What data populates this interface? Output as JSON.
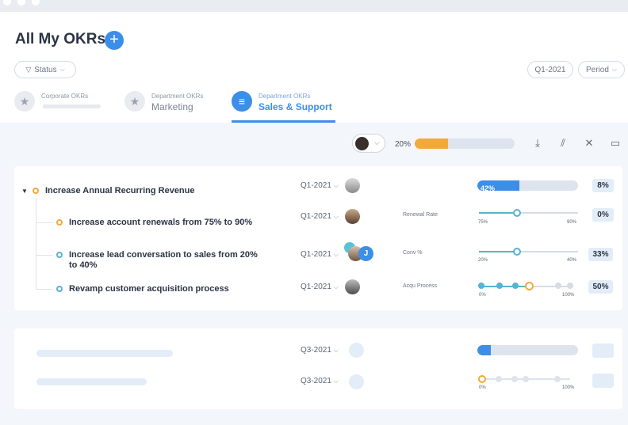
{
  "page": {
    "title": "All My OKRs"
  },
  "filters": {
    "status_label": "Status",
    "quarter_label": "Q1-2021",
    "period_label": "Period"
  },
  "tabs": [
    {
      "sub": "Corporate OKRs",
      "main": ""
    },
    {
      "sub": "Department OKRs",
      "main": "Marketing"
    },
    {
      "sub": "Department OKRs",
      "main": "Sales & Support"
    }
  ],
  "toolbar": {
    "progress_label": "20%",
    "progress": 0.33
  },
  "objective": {
    "title": "Increase Annual Recurring Revenue",
    "quarter": "Q1-2021",
    "progress_label": "42%",
    "progress": 0.42,
    "badge": "8%"
  },
  "key_results": [
    {
      "title": "Increase account renewals from 75% to 90%",
      "quarter": "Q1-2021",
      "metric": "Renewal Rate",
      "start": "75%",
      "end": "90%",
      "value": 0.38,
      "badge": "0%"
    },
    {
      "title": "Increase lead conversation to sales from 20% to 40%",
      "quarter": "Q1-2021",
      "metric": "Conv %",
      "start": "20%",
      "end": "40%",
      "value": 0.38,
      "badge": "33%",
      "assignee_initial": "J"
    },
    {
      "title": "Revamp customer acquisition process",
      "quarter": "Q1-2021",
      "metric": "Acqu Process",
      "start": "0%",
      "end": "100%",
      "milestones": 6,
      "completed": 3,
      "badge": "50%"
    }
  ],
  "placeholder_rows": [
    {
      "quarter": "Q3-2021",
      "progress": 0.13,
      "start": "",
      "end": ""
    },
    {
      "quarter": "Q3-2021",
      "start": "0%",
      "end": "100%"
    }
  ],
  "colors": {
    "accent": "#3d8ee8",
    "orange": "#f2a93b",
    "teal": "#57b3cf"
  }
}
